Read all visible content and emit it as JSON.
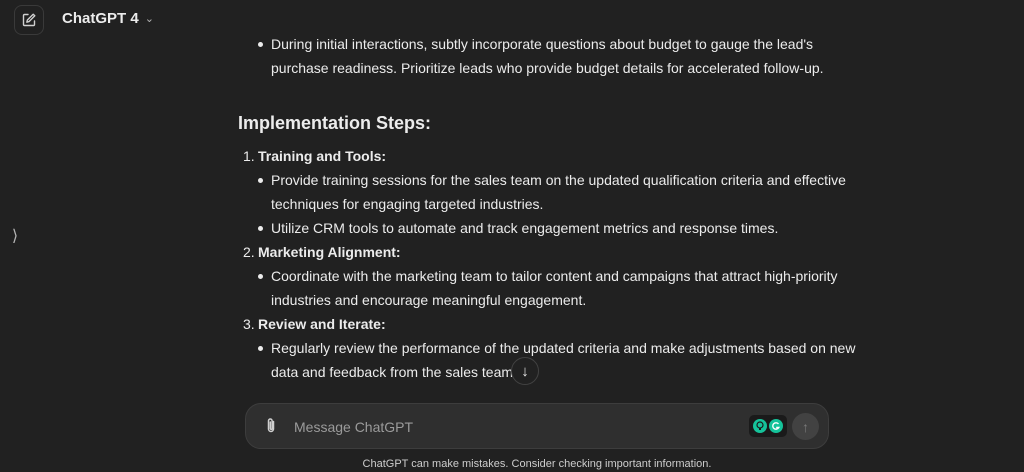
{
  "header": {
    "model_name": "ChatGPT 4",
    "new_chat_icon": "pencil-square-icon",
    "model_chevron_icon": "chevron-down-icon"
  },
  "sidebar": {
    "toggle_icon": "chevron-right-icon",
    "toggle_glyph": "⟩"
  },
  "conversation": {
    "partial_bullet_top": "During initial interactions, subtly incorporate questions about budget to gauge the lead's",
    "partial_bullet_rest": "purchase readiness. Prioritize leads who provide budget details for accelerated follow-up.",
    "heading": "Implementation Steps:",
    "steps": [
      {
        "number": "1.",
        "title": "Training and Tools:",
        "bullets": [
          [
            "Provide training sessions for the sales team on the updated qualification criteria and effective",
            "techniques for engaging targeted industries."
          ],
          [
            "Utilize CRM tools to automate and track engagement metrics and response times."
          ]
        ]
      },
      {
        "number": "2.",
        "title": "Marketing Alignment:",
        "bullets": [
          [
            "Coordinate with the marketing team to tailor content and campaigns that attract high-priority",
            "industries and encourage meaningful engagement."
          ]
        ]
      },
      {
        "number": "3.",
        "title": "Review and Iterate:",
        "bullets": [
          [
            "Regularly review the performance of the updated criteria and make adjustments based on new",
            "data and feedback from the sales team."
          ]
        ]
      }
    ]
  },
  "scroll_down": {
    "icon": "arrow-down-icon",
    "glyph": "↓"
  },
  "composer": {
    "placeholder": "Message ChatGPT",
    "attach_icon": "paperclip-icon",
    "extension_icons": [
      "lightbulb-icon",
      "grammarly-icon"
    ],
    "send_icon": "arrow-up-icon",
    "send_glyph": "↑"
  },
  "footer": {
    "disclaimer": "ChatGPT can make mistakes. Consider checking important information."
  },
  "colors": {
    "background": "#212121",
    "text": "#ececec",
    "composer_bg": "#2f2f2f",
    "extension_green": "#15c39a"
  }
}
